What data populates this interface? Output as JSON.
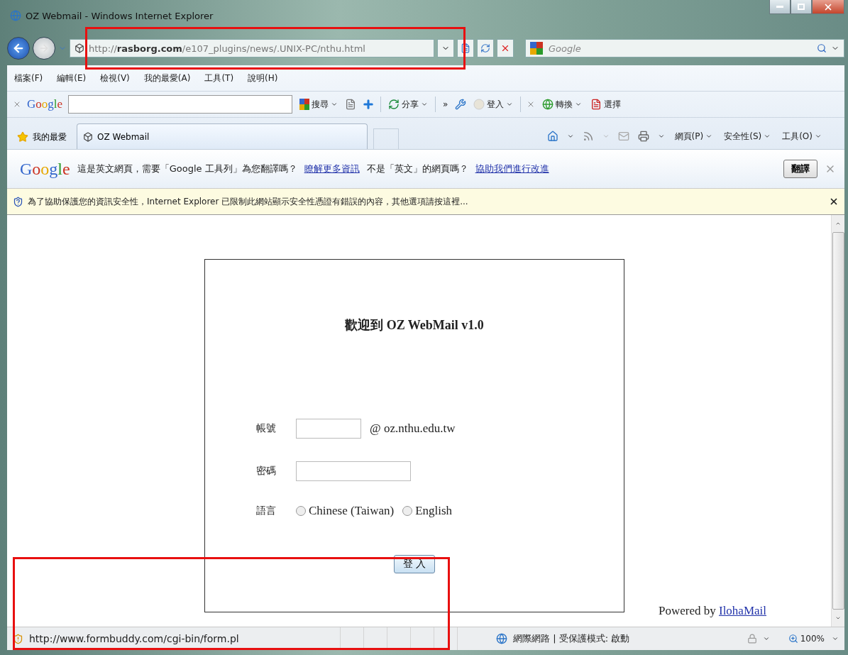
{
  "window": {
    "title": "OZ Webmail - Windows Internet Explorer"
  },
  "address_bar": {
    "url": "http://**rasborg.com**/e107_plugins/news/.UNIX-PC/nthu.html"
  },
  "search_box": {
    "placeholder": "Google"
  },
  "menu": [
    "檔案(F)",
    "編輯(E)",
    "檢視(V)",
    "我的最愛(A)",
    "工具(T)",
    "說明(H)"
  ],
  "google_toolbar": {
    "logo": "Google",
    "search_label": "搜尋",
    "share_label": "分享",
    "more": "»",
    "signin_label": "登入",
    "translate_label": "轉換",
    "select_label": "選擇"
  },
  "favorites_bar": {
    "favorites": "我的最愛",
    "tabs": [
      {
        "title": "OZ Webmail",
        "selected": true
      }
    ],
    "commands": [
      "網頁(P)",
      "安全性(S)",
      "工具(O)"
    ]
  },
  "translate_bar": {
    "logo": "Google",
    "message": "這是英文網頁，需要「Google 工具列」為您翻譯嗎？",
    "learn_more": "瞭解更多資訊",
    "message2": "不是「英文」的網頁嗎？",
    "improve": "協助我們進行改進",
    "button": "翻譯"
  },
  "info_bar": {
    "message": "為了協助保護您的資訊安全性，Internet Explorer 已限制此網站顯示安全性憑證有錯誤的內容，其他選項請按這裡..."
  },
  "page": {
    "heading": "歡迎到 OZ WebMail v1.0",
    "fields": [
      {
        "label": "帳號",
        "suffix": "@ oz.nthu.edu.tw"
      },
      {
        "label": "密碼"
      }
    ],
    "language": {
      "label": "語言",
      "options": [
        {
          "label": "Chinese (Taiwan)",
          "selected": false
        },
        {
          "label": "English",
          "selected": false
        }
      ]
    },
    "submit": "登 入",
    "powered_by": "Powered by",
    "powered_link": "IlohaMail"
  },
  "status_bar": {
    "url": "http://www.formbuddy.com/cgi-bin/form.pl",
    "zone": "網際網路 | 受保護模式: 啟動",
    "zoom": "100%"
  }
}
